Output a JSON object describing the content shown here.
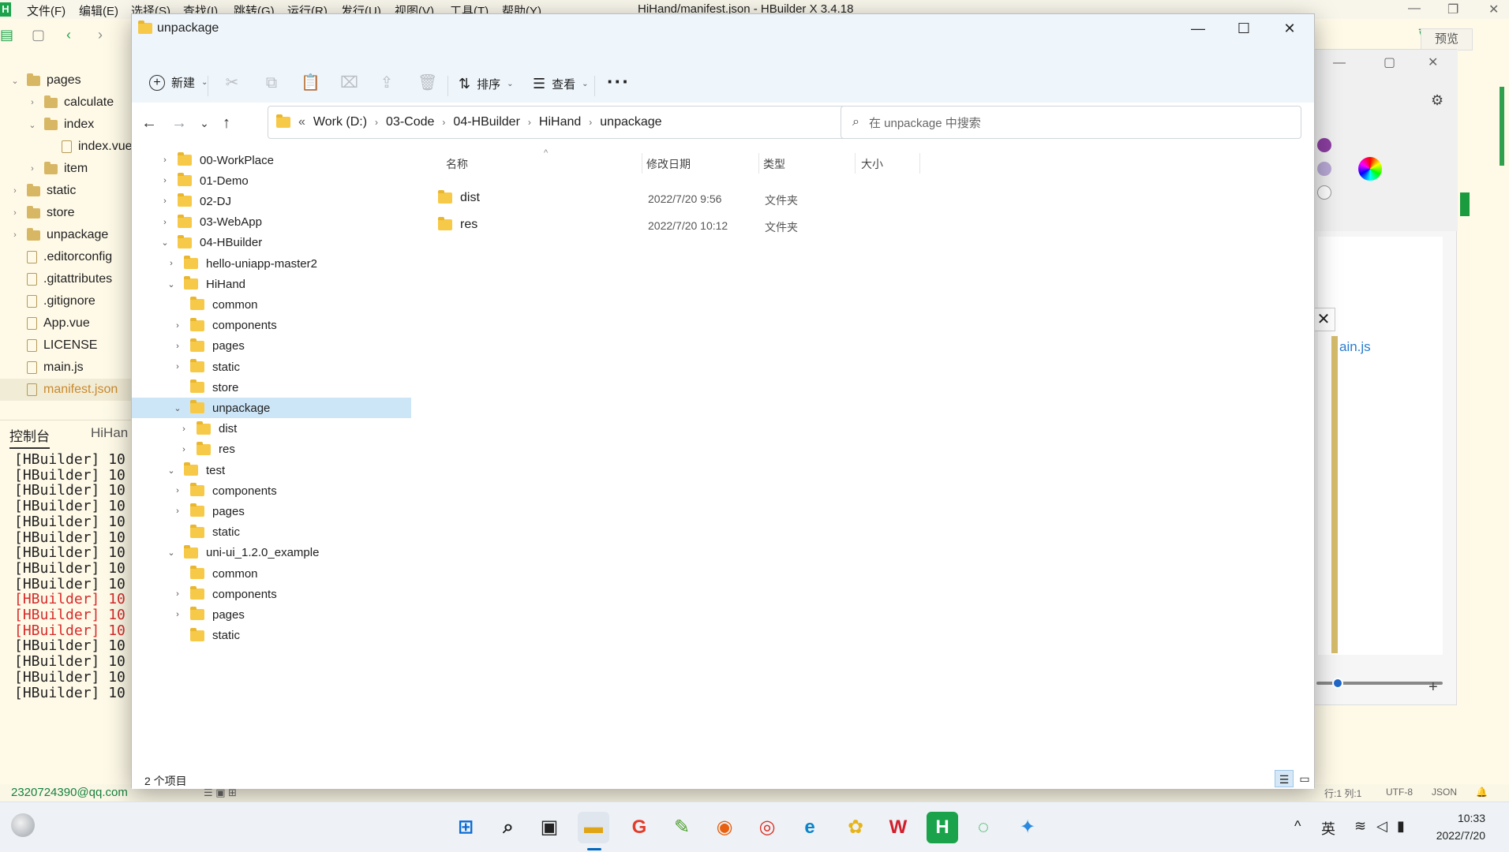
{
  "hbuilder": {
    "menu": [
      "文件(F)",
      "编辑(E)",
      "选择(S)",
      "查找(I)",
      "跳转(G)",
      "运行(R)",
      "发行(U)",
      "视图(V)",
      "工具(T)",
      "帮助(Y)"
    ],
    "window_title": "HiHand/manifest.json - HBuilder X 3.4.18",
    "preview_label": "预览",
    "tree": [
      {
        "label": "pages",
        "type": "folder",
        "expanded": true
      },
      {
        "label": "calculate",
        "type": "folder"
      },
      {
        "label": "index",
        "type": "folder",
        "expanded": true
      },
      {
        "label": "index.vue",
        "type": "file"
      },
      {
        "label": "item",
        "type": "folder"
      },
      {
        "label": "static",
        "type": "folder"
      },
      {
        "label": "store",
        "type": "folder"
      },
      {
        "label": "unpackage",
        "type": "folder"
      },
      {
        "label": ".editorconfig",
        "type": "file"
      },
      {
        "label": ".gitattributes",
        "type": "file"
      },
      {
        "label": ".gitignore",
        "type": "file"
      },
      {
        "label": "App.vue",
        "type": "file"
      },
      {
        "label": "LICENSE",
        "type": "file"
      },
      {
        "label": "main.js",
        "type": "file"
      },
      {
        "label": "manifest.json",
        "type": "file",
        "selected": true
      }
    ],
    "console_tab": "控制台",
    "console_tab2": "HiHan",
    "console_lines": [
      {
        "text": "[HBuilder] 10",
        "error": false
      },
      {
        "text": "[HBuilder] 10",
        "error": false
      },
      {
        "text": "[HBuilder] 10",
        "error": false
      },
      {
        "text": "[HBuilder] 10",
        "error": false
      },
      {
        "text": "[HBuilder] 10",
        "error": false
      },
      {
        "text": "[HBuilder] 10",
        "error": false
      },
      {
        "text": "[HBuilder] 10",
        "error": false
      },
      {
        "text": "[HBuilder] 10",
        "error": false
      },
      {
        "text": "[HBuilder] 10",
        "error": false
      },
      {
        "text": "[HBuilder] 10",
        "error": true
      },
      {
        "text": "[HBuilder] 10",
        "error": true
      },
      {
        "text": "[HBuilder] 10",
        "error": true
      },
      {
        "text": "[HBuilder] 10",
        "error": false
      },
      {
        "text": "[HBuilder] 10",
        "error": false
      },
      {
        "text": "[HBuilder] 10",
        "error": false
      },
      {
        "text": "[HBuilder] 10",
        "error": false
      }
    ],
    "status": {
      "email": "2320724390@qq.com",
      "position": "行:1  列:1",
      "encoding": "UTF-8",
      "language": "JSON"
    },
    "side_label": "ain.js"
  },
  "explorer": {
    "title": "unpackage",
    "commands": {
      "new": "新建",
      "sort": "排序",
      "view": "查看",
      "more": "···"
    },
    "breadcrumb": [
      "Work (D:)",
      "03-Code",
      "04-HBuilder",
      "HiHand",
      "unpackage"
    ],
    "breadcrumb_prefix": "«",
    "search_placeholder": "在 unpackage 中搜索",
    "nav_tree": [
      {
        "label": "00-WorkPlace",
        "caret": "›",
        "level": 0
      },
      {
        "label": "01-Demo",
        "caret": "›",
        "level": 0
      },
      {
        "label": "02-DJ",
        "caret": "›",
        "level": 0
      },
      {
        "label": "03-WebApp",
        "caret": "›",
        "level": 0
      },
      {
        "label": "04-HBuilder",
        "caret": "⌄",
        "level": 0
      },
      {
        "label": "hello-uniapp-master2",
        "caret": "›",
        "level": 1
      },
      {
        "label": "HiHand",
        "caret": "⌄",
        "level": 1
      },
      {
        "label": "common",
        "caret": "",
        "level": 2
      },
      {
        "label": "components",
        "caret": "›",
        "level": 2
      },
      {
        "label": "pages",
        "caret": "›",
        "level": 2
      },
      {
        "label": "static",
        "caret": "›",
        "level": 2
      },
      {
        "label": "store",
        "caret": "",
        "level": 2
      },
      {
        "label": "unpackage",
        "caret": "⌄",
        "level": 2,
        "selected": true
      },
      {
        "label": "dist",
        "caret": "›",
        "level": 3
      },
      {
        "label": "res",
        "caret": "›",
        "level": 3
      },
      {
        "label": "test",
        "caret": "⌄",
        "level": 1
      },
      {
        "label": "components",
        "caret": "›",
        "level": 2
      },
      {
        "label": "pages",
        "caret": "›",
        "level": 2
      },
      {
        "label": "static",
        "caret": "",
        "level": 2
      },
      {
        "label": "uni-ui_1.2.0_example",
        "caret": "⌄",
        "level": 1
      },
      {
        "label": "common",
        "caret": "",
        "level": 2
      },
      {
        "label": "components",
        "caret": "›",
        "level": 2
      },
      {
        "label": "pages",
        "caret": "›",
        "level": 2
      },
      {
        "label": "static",
        "caret": "",
        "level": 2
      }
    ],
    "columns": {
      "name": "名称",
      "modified": "修改日期",
      "type": "类型",
      "size": "大小"
    },
    "files": [
      {
        "name": "dist",
        "modified": "2022/7/20 9:56",
        "type": "文件夹",
        "size": ""
      },
      {
        "name": "res",
        "modified": "2022/7/20 10:12",
        "type": "文件夹",
        "size": ""
      }
    ],
    "item_count": "2 个项目"
  },
  "taskbar": {
    "apps": [
      "start",
      "search",
      "terminal",
      "file-explorer",
      "app-red-g",
      "app-notepad",
      "firefox",
      "chrome",
      "edge",
      "app-yellow",
      "wps",
      "hbuilder",
      "wechat",
      "app-blue"
    ],
    "ime": "英",
    "time": "10:33",
    "date": "2022/7/20"
  },
  "colors": {
    "explorer_accent": "#0067c0",
    "selection": "#cde6f7",
    "folder": "#f7c948",
    "hbuilder_error": "#d42a2a",
    "hbuilder_green": "#1aa34a"
  }
}
